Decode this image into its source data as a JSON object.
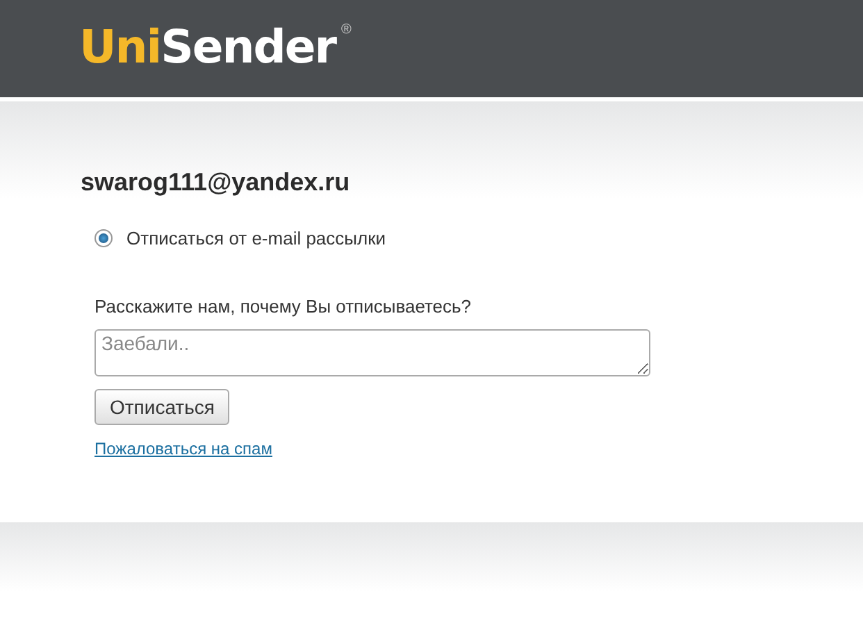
{
  "header": {
    "logo": [
      "Uni",
      "Sender"
    ],
    "registered_mark": "®"
  },
  "email": "swarog111@yandex.ru",
  "options": [
    {
      "label": "Отписаться от e-mail рассылки",
      "selected": true
    }
  ],
  "reason": {
    "label": "Расскажите нам, почему Вы отписываетесь?",
    "placeholder": "Заебали.."
  },
  "submit_button": "Отписаться",
  "spam_link": "Пожаловаться на спам"
}
